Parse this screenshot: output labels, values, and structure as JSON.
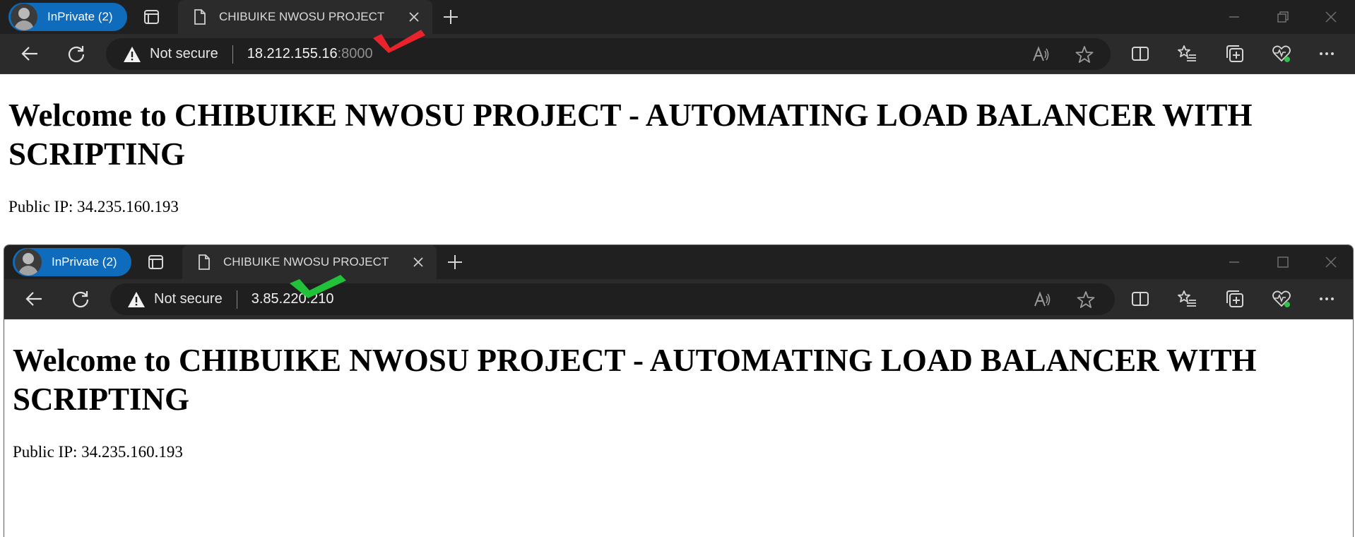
{
  "windows": [
    {
      "profile_label": "InPrivate (2)",
      "tab_title": "CHIBUIKE NWOSU PROJECT",
      "security_text": "Not secure",
      "url_host": "18.212.155.16",
      "url_port": ":8000",
      "heading": "Welcome to CHIBUIKE NWOSU PROJECT - AUTOMATING LOAD BALANCER WITH SCRIPTING",
      "ip_text": "Public IP: 34.235.160.193",
      "annotation": "red-cross-mark",
      "annotation_color": "#e8232b"
    },
    {
      "profile_label": "InPrivate (2)",
      "tab_title": "CHIBUIKE NWOSU PROJECT",
      "security_text": "Not secure",
      "url_host": "3.85.220.210",
      "url_port": "",
      "heading": "Welcome to CHIBUIKE NWOSU PROJECT - AUTOMATING LOAD BALANCER WITH SCRIPTING",
      "ip_text": "Public IP: 34.235.160.193",
      "annotation": "green-check-mark",
      "annotation_color": "#22c13a"
    }
  ],
  "icons": {
    "tab_actions": "tab-actions-icon",
    "page": "page-icon",
    "close": "close-icon",
    "new_tab": "plus-icon",
    "back": "back-arrow-icon",
    "refresh": "refresh-icon",
    "warning": "warning-icon",
    "read_aloud": "read-aloud-icon",
    "favorite": "star-icon",
    "split_screen": "split-screen-icon",
    "favorites": "favorites-icon",
    "collections": "collections-icon",
    "browser_essentials": "heartbeat-icon",
    "more": "more-icon"
  },
  "colors": {
    "tab_bar": "#202020",
    "toolbar": "#2b2b2b",
    "profile_pill": "#0f6cbd",
    "essentials_dot": "#2fc24a"
  }
}
